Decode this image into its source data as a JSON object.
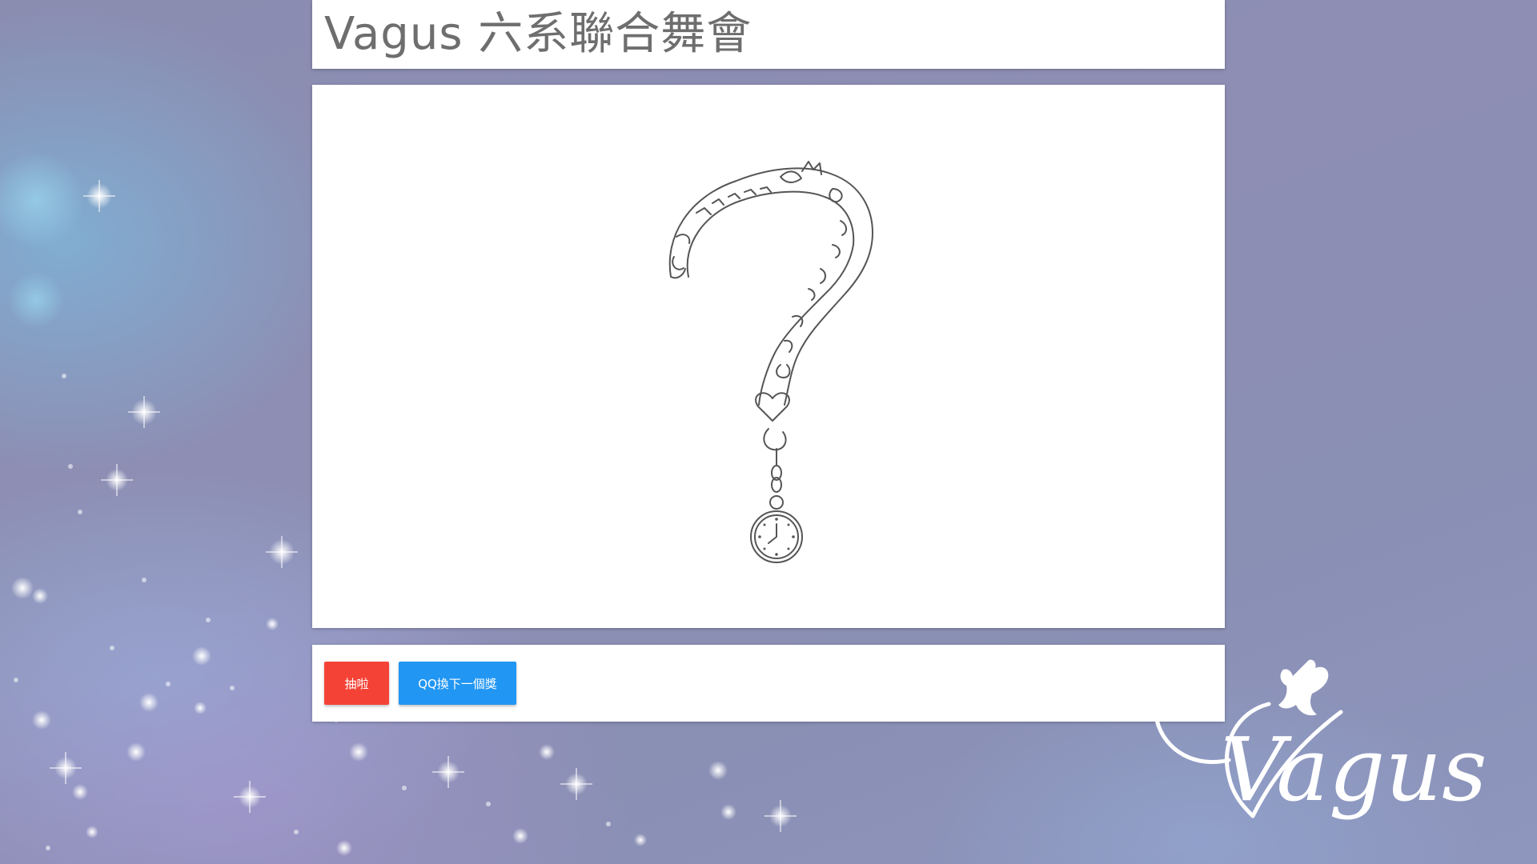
{
  "page": {
    "title": "Vagus 六系聯合舞會"
  },
  "image": {
    "description_icon": "question-mark-doodle-with-pocket-watch"
  },
  "buttons": {
    "draw_label": "抽啦",
    "next_label": "QQ換下一個獎"
  },
  "logo": {
    "text": "Vagus"
  },
  "colors": {
    "draw_button": "#f44336",
    "next_button": "#2196f3",
    "title_text": "#6e6e6e"
  }
}
